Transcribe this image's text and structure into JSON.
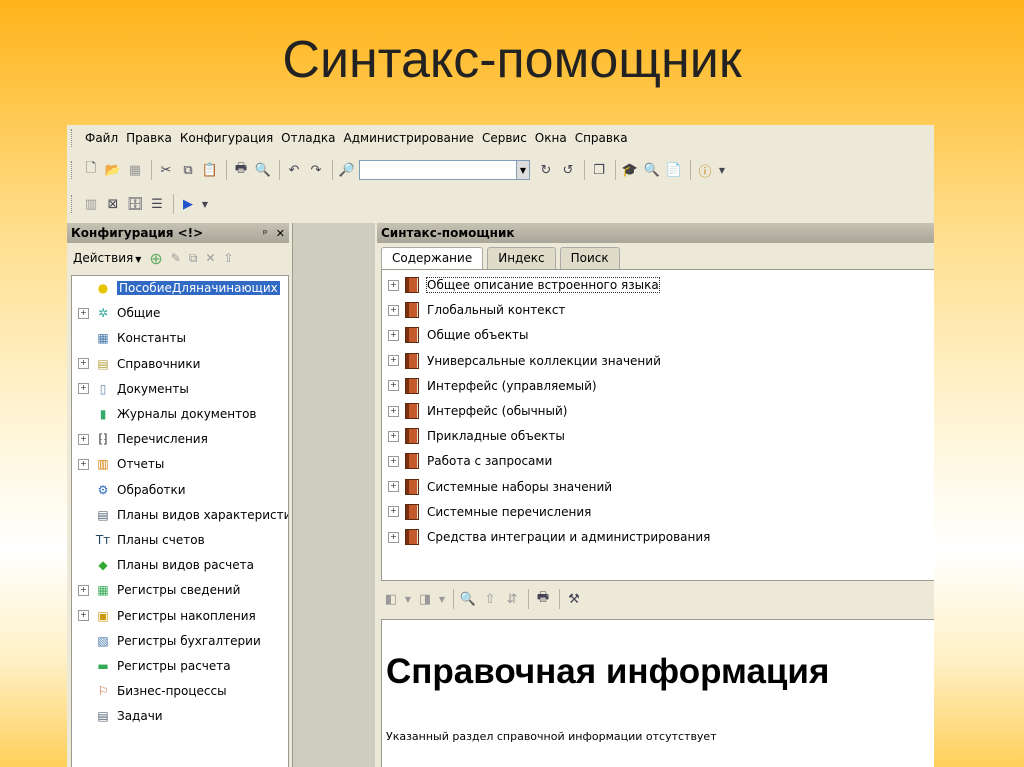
{
  "slide": {
    "title": "Синтакс-помощник"
  },
  "menu": {
    "items": [
      "Файл",
      "Правка",
      "Конфигурация",
      "Отладка",
      "Администрирование",
      "Сервис",
      "Окна",
      "Справка"
    ]
  },
  "toolbar1": {
    "icons": [
      "new-document-icon",
      "open-folder-icon",
      "save-icon",
      "cut-icon",
      "copy-icon",
      "paste-icon",
      "print-icon",
      "print-preview-icon",
      "undo-icon",
      "redo-icon",
      "find-icon"
    ],
    "search_value": "",
    "icons_after": [
      "search-next-icon",
      "search-prev-icon",
      "window-icon",
      "wizard-icon",
      "syntax-help-icon",
      "notes-icon",
      "info-icon"
    ]
  },
  "toolbar2": {
    "icons": [
      "config-icon",
      "compare-icon",
      "database-icon",
      "list-icon",
      "run-debug-icon"
    ]
  },
  "left_panel": {
    "title": "Конфигурация <!>",
    "pin": "ᵖ",
    "close": "✕",
    "actions_label": "Действия",
    "tree": [
      {
        "label": "ПособиеДляначинающих",
        "expander": false,
        "icon": "config-root-icon",
        "selected": true
      },
      {
        "label": "Общие",
        "expander": true,
        "icon": "common-icon"
      },
      {
        "label": "Константы",
        "expander": false,
        "icon": "constants-icon"
      },
      {
        "label": "Справочники",
        "expander": true,
        "icon": "catalogs-icon"
      },
      {
        "label": "Документы",
        "expander": true,
        "icon": "documents-icon"
      },
      {
        "label": "Журналы документов",
        "expander": false,
        "icon": "journals-icon"
      },
      {
        "label": "Перечисления",
        "expander": true,
        "icon": "enums-icon"
      },
      {
        "label": "Отчеты",
        "expander": true,
        "icon": "reports-icon"
      },
      {
        "label": "Обработки",
        "expander": false,
        "icon": "processing-icon"
      },
      {
        "label": "Планы видов характеристик",
        "expander": false,
        "icon": "char-types-icon"
      },
      {
        "label": "Планы счетов",
        "expander": false,
        "icon": "charts-of-accounts-icon"
      },
      {
        "label": "Планы видов расчета",
        "expander": false,
        "icon": "calc-types-icon"
      },
      {
        "label": "Регистры сведений",
        "expander": true,
        "icon": "info-registers-icon"
      },
      {
        "label": "Регистры накопления",
        "expander": true,
        "icon": "accum-registers-icon"
      },
      {
        "label": "Регистры бухгалтерии",
        "expander": false,
        "icon": "accounting-registers-icon"
      },
      {
        "label": "Регистры расчета",
        "expander": false,
        "icon": "calc-registers-icon"
      },
      {
        "label": "Бизнес-процессы",
        "expander": false,
        "icon": "business-processes-icon"
      },
      {
        "label": "Задачи",
        "expander": false,
        "icon": "tasks-icon"
      }
    ]
  },
  "right_panel": {
    "title": "Синтакс-помощник",
    "tabs": [
      {
        "label": "Содержание",
        "active": true
      },
      {
        "label": "Индекс",
        "active": false
      },
      {
        "label": "Поиск",
        "active": false
      }
    ],
    "contents": [
      "Общее описание встроенного языка",
      "Глобальный контекст",
      "Общие объекты",
      "Универсальные коллекции значений",
      "Интерфейс (управляемый)",
      "Интерфейс (обычный)",
      "Прикладные объекты",
      "Работа с запросами",
      "Системные наборы значений",
      "Системные перечисления",
      "Средства интеграции и администрирования"
    ],
    "info_heading": "Справочная информация",
    "info_text": "Указанный раздел справочной информации отсутствует"
  }
}
